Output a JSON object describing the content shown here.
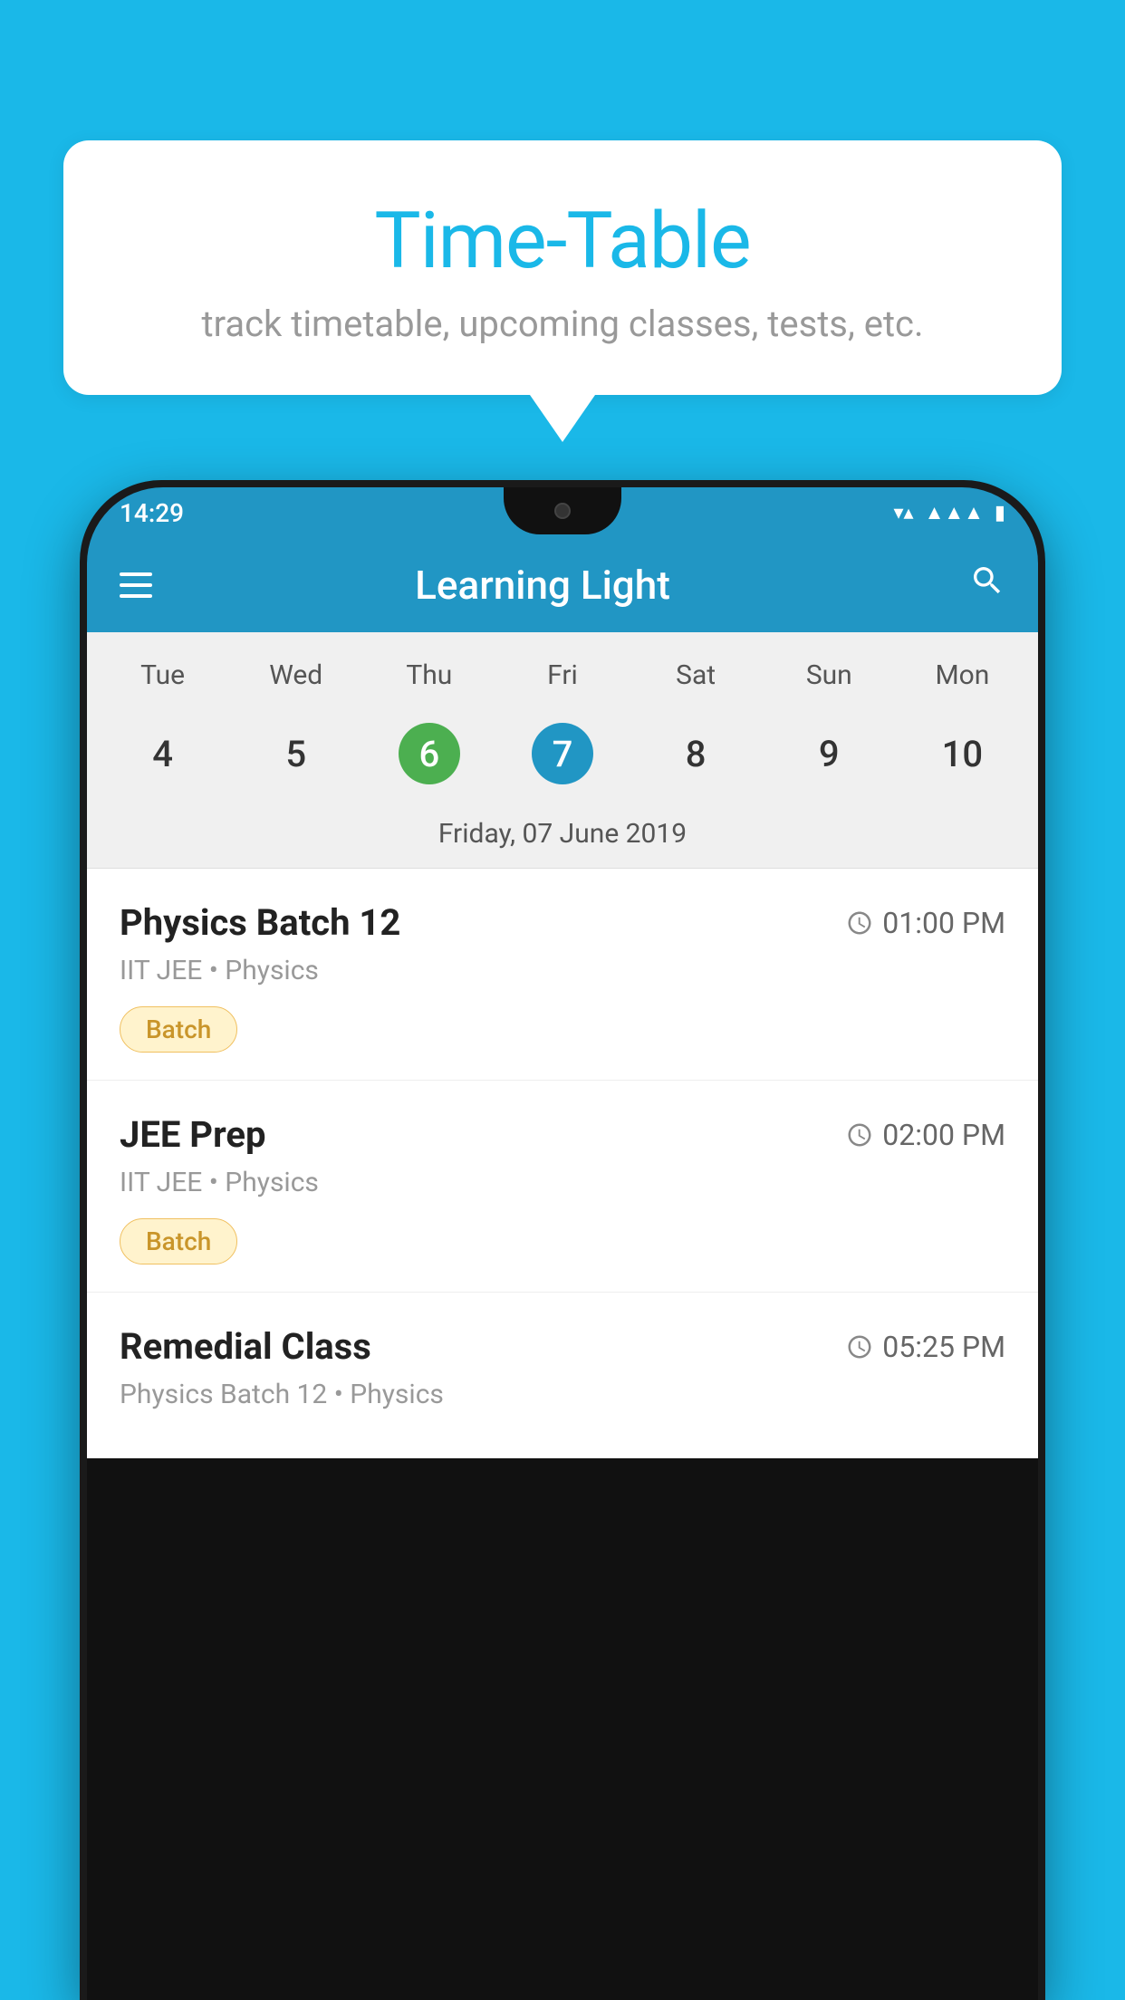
{
  "background_color": "#1ab8e8",
  "speech_bubble": {
    "title": "Time-Table",
    "subtitle": "track timetable, upcoming classes, tests, etc."
  },
  "app": {
    "name": "Learning Light",
    "status_bar": {
      "time": "14:29",
      "icons": [
        "wifi",
        "signal",
        "battery"
      ]
    }
  },
  "calendar": {
    "selected_date_label": "Friday, 07 June 2019",
    "days": [
      {
        "name": "Tue",
        "number": "4",
        "state": "normal"
      },
      {
        "name": "Wed",
        "number": "5",
        "state": "normal"
      },
      {
        "name": "Thu",
        "number": "6",
        "state": "today"
      },
      {
        "name": "Fri",
        "number": "7",
        "state": "selected"
      },
      {
        "name": "Sat",
        "number": "8",
        "state": "normal"
      },
      {
        "name": "Sun",
        "number": "9",
        "state": "normal"
      },
      {
        "name": "Mon",
        "number": "10",
        "state": "normal"
      }
    ]
  },
  "schedule_items": [
    {
      "title": "Physics Batch 12",
      "time": "01:00 PM",
      "subtitle": "IIT JEE • Physics",
      "badge": "Batch"
    },
    {
      "title": "JEE Prep",
      "time": "02:00 PM",
      "subtitle": "IIT JEE • Physics",
      "badge": "Batch"
    },
    {
      "title": "Remedial Class",
      "time": "05:25 PM",
      "subtitle": "Physics Batch 12 • Physics",
      "badge": null
    }
  ],
  "icons": {
    "hamburger": "☰",
    "search": "🔍",
    "clock": "🕐"
  }
}
